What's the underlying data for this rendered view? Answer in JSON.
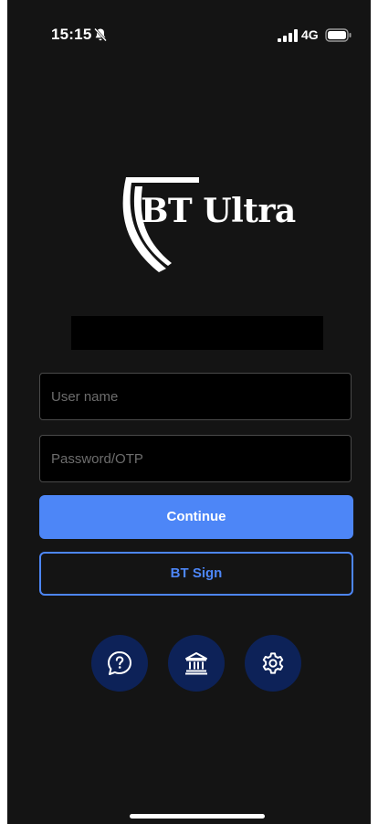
{
  "status_bar": {
    "time": "15:15",
    "network": "4G",
    "icons": [
      "bell-slash-icon",
      "signal-icon",
      "battery-icon"
    ]
  },
  "logo": {
    "text": "BT Ultra",
    "icon": "shield-logo"
  },
  "login": {
    "username_placeholder": "User name",
    "username_value": "",
    "password_placeholder": "Password/OTP",
    "password_value": "",
    "continue_label": "Continue",
    "bt_sign_label": "BT Sign"
  },
  "quick_actions": [
    {
      "icon": "help-chat-icon"
    },
    {
      "icon": "bank-icon"
    },
    {
      "icon": "gear-icon"
    }
  ],
  "colors": {
    "background": "#141414",
    "accent": "#4d86f7",
    "round_button": "#0d2258",
    "field_background": "#000000",
    "field_border": "#4a4a4a"
  }
}
